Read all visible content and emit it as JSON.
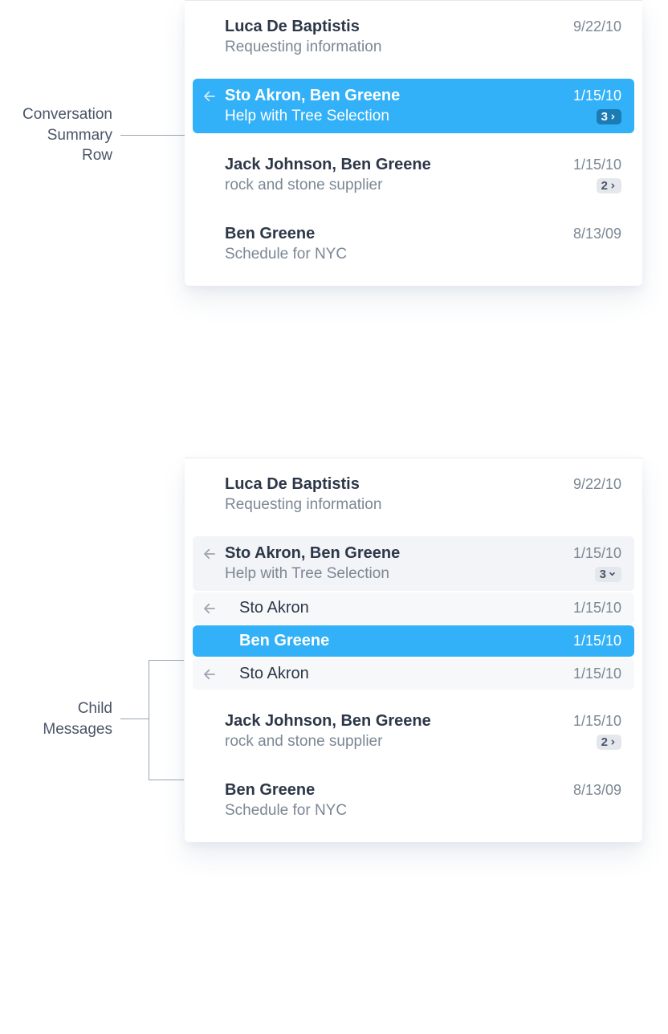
{
  "annotations": {
    "summaryRow": "Conversation\nSummary\nRow",
    "childMessages": "Child\nMessages"
  },
  "panel1": {
    "rows": [
      {
        "name": "Luca De Baptistis",
        "date": "9/22/10",
        "subject": "Requesting information"
      },
      {
        "name": "Sto Akron, Ben Greene",
        "date": "1/15/10",
        "subject": "Help with Tree Selection",
        "badge": "3"
      },
      {
        "name": "Jack Johnson, Ben Greene",
        "date": "1/15/10",
        "subject": "rock and stone supplier",
        "badge": "2"
      },
      {
        "name": "Ben Greene",
        "date": "8/13/09",
        "subject": "Schedule for NYC"
      }
    ]
  },
  "panel2": {
    "rows": [
      {
        "name": "Luca De Baptistis",
        "date": "9/22/10",
        "subject": "Requesting information"
      },
      {
        "name": "Sto Akron, Ben Greene",
        "date": "1/15/10",
        "subject": "Help with Tree Selection",
        "badge": "3"
      }
    ],
    "children": [
      {
        "name": "Sto Akron",
        "date": "1/15/10"
      },
      {
        "name": "Ben Greene",
        "date": "1/15/10"
      },
      {
        "name": "Sto Akron",
        "date": "1/15/10"
      }
    ],
    "after": [
      {
        "name": "Jack Johnson, Ben Greene",
        "date": "1/15/10",
        "subject": "rock and stone supplier",
        "badge": "2"
      },
      {
        "name": "Ben Greene",
        "date": "8/13/09",
        "subject": "Schedule for NYC"
      }
    ]
  }
}
